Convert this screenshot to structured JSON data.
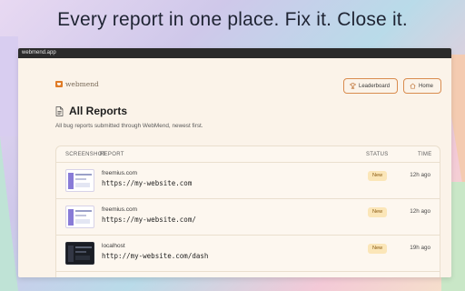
{
  "headline": "Every report in one place. Fix it. Close it.",
  "window": {
    "title": "webmend.app"
  },
  "brand": {
    "name": "webmend",
    "accent": "#e07b26"
  },
  "nav": {
    "leaderboard_label": "Leaderboard",
    "home_label": "Home"
  },
  "page": {
    "title": "All Reports",
    "subtitle": "All bug reports submitted through WebMend, newest first."
  },
  "table": {
    "columns": {
      "screenshot": "SCREENSHOT",
      "report": "REPORT",
      "status": "STATUS",
      "time": "TIME"
    },
    "rows": [
      {
        "host": "freemius.com",
        "url": "https://my-website.com",
        "status": "New",
        "time": "12h ago",
        "thumb": "light"
      },
      {
        "host": "freemius.com",
        "url": "https://my-website.com/",
        "status": "New",
        "time": "12h ago",
        "thumb": "light"
      },
      {
        "host": "localhost",
        "url": "http://my-website.com/dash",
        "status": "New",
        "time": "19h ago",
        "thumb": "dark"
      }
    ]
  }
}
